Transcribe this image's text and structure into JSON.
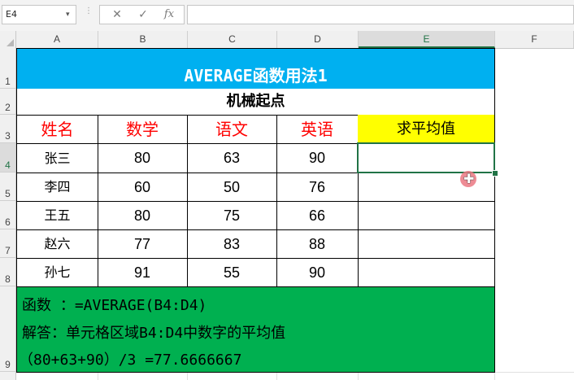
{
  "formula_bar": {
    "name_box": "E4",
    "name_box_arrow": "▾",
    "cancel_icon": "✕",
    "enter_icon": "✓",
    "fx_label": "fx",
    "formula": ""
  },
  "columns": [
    "A",
    "B",
    "C",
    "D",
    "E",
    "F"
  ],
  "rows": [
    "1",
    "2",
    "3",
    "4",
    "5",
    "6",
    "7",
    "8",
    "9"
  ],
  "selected_cell": "E4",
  "sheet": {
    "title": "AVERAGE函数用法1",
    "subtitle": "机械起点",
    "headers": [
      "姓名",
      "数学",
      "语文",
      "英语",
      "求平均值"
    ],
    "data_rows": [
      {
        "name": "张三",
        "math": "80",
        "chinese": "63",
        "english": "90",
        "avg": ""
      },
      {
        "name": "李四",
        "math": "60",
        "chinese": "50",
        "english": "76",
        "avg": ""
      },
      {
        "name": "王五",
        "math": "80",
        "chinese": "75",
        "english": "66",
        "avg": ""
      },
      {
        "name": "赵六",
        "math": "77",
        "chinese": "83",
        "english": "88",
        "avg": ""
      },
      {
        "name": "孙七",
        "math": "91",
        "chinese": "55",
        "english": "90",
        "avg": ""
      }
    ],
    "notes": [
      "函数 ：=AVERAGE(B4:D4)",
      "解答：单元格区域B4:D4中数字的平均值",
      "（80+63+90）/3 =77.6666667"
    ]
  },
  "colors": {
    "title_bg": "#00b0f0",
    "header_text": "#ff0000",
    "average_header_bg": "#ffff00",
    "notes_bg": "#00b050",
    "selection": "#217346"
  },
  "icons": {
    "cursor": "plus-cursor-icon"
  }
}
